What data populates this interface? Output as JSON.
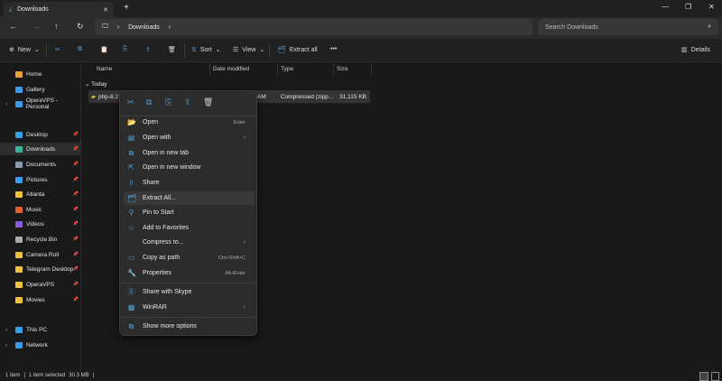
{
  "window": {
    "tab_title": "Downloads",
    "close_tab": "✕",
    "new_tab": "+"
  },
  "nav": {
    "back": "←",
    "forward": "→",
    "up": "↑",
    "refresh": "↻",
    "breadcrumb": [
      "Downloads"
    ],
    "search_placeholder": "Search Downloads"
  },
  "toolbar": {
    "new": "New",
    "sort": "Sort",
    "view": "View",
    "extract_all": "Extract all",
    "more": "•••",
    "details": "Details"
  },
  "sidebar": {
    "items": [
      {
        "label": "Home",
        "icon": "home-icon",
        "color": "#e8a33c"
      },
      {
        "label": "Gallery",
        "icon": "gallery-icon",
        "color": "#3d9be9"
      },
      {
        "label": "OperaVPS - Personal",
        "icon": "onedrive-icon",
        "color": "#3d9be9",
        "expandable": true
      },
      {
        "label": "Desktop",
        "icon": "desktop-icon",
        "color": "#3d9be9",
        "pinned": true
      },
      {
        "label": "Downloads",
        "icon": "downloads-icon",
        "color": "#3ab39a",
        "pinned": true,
        "selected": true
      },
      {
        "label": "Documents",
        "icon": "documents-icon",
        "color": "#8a9bb0",
        "pinned": true
      },
      {
        "label": "Pictures",
        "icon": "pictures-icon",
        "color": "#3d9be9",
        "pinned": true
      },
      {
        "label": "Atlanta",
        "icon": "folder-icon",
        "color": "#f0c040",
        "pinned": true
      },
      {
        "label": "Music",
        "icon": "music-icon",
        "color": "#e0603a",
        "pinned": true
      },
      {
        "label": "Videos",
        "icon": "videos-icon",
        "color": "#8a5cd6",
        "pinned": true
      },
      {
        "label": "Recycle Bin",
        "icon": "recycle-bin-icon",
        "color": "#aaaaaa",
        "pinned": true
      },
      {
        "label": "Camera Roll",
        "icon": "folder-icon",
        "color": "#f0c040",
        "pinned": true
      },
      {
        "label": "Telegram Desktop",
        "icon": "folder-icon",
        "color": "#f0c040",
        "pinned": true
      },
      {
        "label": "OperaVPS",
        "icon": "folder-icon",
        "color": "#f0c040",
        "pinned": true
      },
      {
        "label": "Movies",
        "icon": "folder-icon",
        "color": "#f0c040",
        "pinned": true
      },
      {
        "label": "This PC",
        "icon": "pc-icon",
        "color": "#3d9be9",
        "expandable": true
      },
      {
        "label": "Network",
        "icon": "network-icon",
        "color": "#3d9be9",
        "expandable": true
      }
    ]
  },
  "columns": [
    "Name",
    "Date modified",
    "Type",
    "Size"
  ],
  "group": "Today",
  "file": {
    "name": "php-8.2",
    "date": "AM",
    "type": "Compressed (zipp...",
    "size": "31,115 KB"
  },
  "context_menu": {
    "items": [
      {
        "label": "Open",
        "shortcut": "Enter",
        "icon": "folder-open-icon"
      },
      {
        "label": "Open with",
        "submenu": true,
        "icon": "open-with-icon"
      },
      {
        "label": "Open in new tab",
        "icon": "new-tab-icon"
      },
      {
        "label": "Open in new window",
        "icon": "new-window-icon"
      },
      {
        "label": "Share",
        "icon": "share-icon"
      },
      {
        "label": "Extract All...",
        "icon": "extract-icon",
        "highlighted": true
      },
      {
        "label": "Pin to Start",
        "icon": "pin-icon"
      },
      {
        "label": "Add to Favorites",
        "icon": "star-icon"
      },
      {
        "label": "Compress to...",
        "submenu": true,
        "icon": ""
      },
      {
        "label": "Copy as path",
        "shortcut": "Ctrl+Shift+C",
        "icon": "copy-path-icon"
      },
      {
        "label": "Properties",
        "shortcut": "Alt+Enter",
        "icon": "properties-icon"
      },
      {
        "label": "Share with Skype",
        "icon": "skype-icon"
      },
      {
        "label": "WinRAR",
        "submenu": true,
        "icon": "winrar-icon"
      },
      {
        "label": "Show more options",
        "icon": "more-options-icon"
      }
    ]
  },
  "status": {
    "count": "1 item",
    "selected": "1 item selected",
    "size": "30.3 MB"
  }
}
